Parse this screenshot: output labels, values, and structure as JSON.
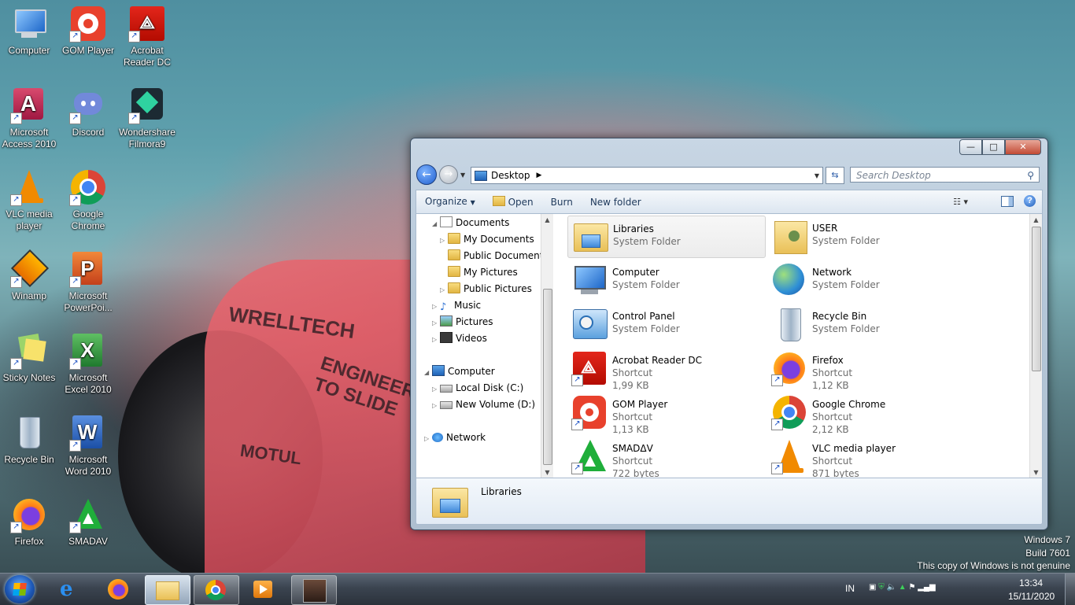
{
  "desktop": {
    "icons": [
      {
        "label": "Computer",
        "icon": "computer-icon"
      },
      {
        "label": "GOM Player",
        "icon": "gom-player-icon"
      },
      {
        "label": "Acrobat Reader DC",
        "icon": "acrobat-icon"
      },
      {
        "label": "Microsoft Access 2010",
        "icon": "access-icon"
      },
      {
        "label": "Discord",
        "icon": "discord-icon"
      },
      {
        "label": "Wondershare Filmora9",
        "icon": "filmora-icon"
      },
      {
        "label": "VLC media player",
        "icon": "vlc-icon"
      },
      {
        "label": "Google Chrome",
        "icon": "chrome-icon"
      },
      {
        "label": "Winamp",
        "icon": "winamp-icon"
      },
      {
        "label": "Microsoft PowerPoi...",
        "icon": "powerpoint-icon"
      },
      {
        "label": "Sticky Notes",
        "icon": "sticky-notes-icon"
      },
      {
        "label": "Microsoft Excel 2010",
        "icon": "excel-icon"
      },
      {
        "label": "Recycle Bin",
        "icon": "recycle-bin-icon"
      },
      {
        "label": "Microsoft Word 2010",
        "icon": "word-icon"
      },
      {
        "label": "Firefox",
        "icon": "firefox-icon"
      },
      {
        "label": "SMADAV",
        "icon": "smadav-icon"
      }
    ]
  },
  "wallpaper_text": [
    "WRELLTECH",
    "ENGINEERED TO SLIDE",
    "MOTUL"
  ],
  "window": {
    "address": "Desktop",
    "search_placeholder": "Search Desktop",
    "buttons": {
      "minimize": "—",
      "maximize": "□",
      "close": "✕"
    },
    "toolbar": {
      "organize": "Organize",
      "open": "Open",
      "burn": "Burn",
      "new_folder": "New folder"
    },
    "tree": [
      {
        "label": "Documents",
        "level": 1,
        "expander": "open"
      },
      {
        "label": "My Documents",
        "level": 2,
        "expander": "closed"
      },
      {
        "label": "Public Documents",
        "level": 2,
        "expander": "none"
      },
      {
        "label": "My Pictures",
        "level": 2,
        "expander": "none"
      },
      {
        "label": "Public Pictures",
        "level": 2,
        "expander": "closed"
      },
      {
        "label": "Music",
        "level": 1,
        "expander": "closed"
      },
      {
        "label": "Pictures",
        "level": 1,
        "expander": "closed"
      },
      {
        "label": "Videos",
        "level": 1,
        "expander": "closed"
      },
      {
        "label": "Computer",
        "level": 0,
        "expander": "open"
      },
      {
        "label": "Local Disk (C:)",
        "level": 1,
        "expander": "closed"
      },
      {
        "label": "New Volume (D:)",
        "level": 1,
        "expander": "closed"
      },
      {
        "label": "Network",
        "level": 0,
        "expander": "closed"
      }
    ],
    "items": [
      {
        "name": "Libraries",
        "type": "System Folder",
        "size": "",
        "icon": "libraries-icon",
        "selected": true
      },
      {
        "name": "USER",
        "type": "System Folder",
        "size": "",
        "icon": "user-folder-icon"
      },
      {
        "name": "Computer",
        "type": "System Folder",
        "size": "",
        "icon": "computer-icon"
      },
      {
        "name": "Network",
        "type": "System Folder",
        "size": "",
        "icon": "network-icon"
      },
      {
        "name": "Control Panel",
        "type": "System Folder",
        "size": "",
        "icon": "control-panel-icon"
      },
      {
        "name": "Recycle Bin",
        "type": "System Folder",
        "size": "",
        "icon": "recycle-bin-icon"
      },
      {
        "name": "Acrobat Reader DC",
        "type": "Shortcut",
        "size": "1,99 KB",
        "icon": "acrobat-icon"
      },
      {
        "name": "Firefox",
        "type": "Shortcut",
        "size": "1,12 KB",
        "icon": "firefox-icon"
      },
      {
        "name": "GOM Player",
        "type": "Shortcut",
        "size": "1,13 KB",
        "icon": "gom-player-icon"
      },
      {
        "name": "Google Chrome",
        "type": "Shortcut",
        "size": "2,12 KB",
        "icon": "chrome-icon"
      },
      {
        "name": "SMADΔV",
        "type": "Shortcut",
        "size": "722 bytes",
        "icon": "smadav-icon"
      },
      {
        "name": "VLC media player",
        "type": "Shortcut",
        "size": "871 bytes",
        "icon": "vlc-icon"
      }
    ],
    "details": {
      "name": "Libraries",
      "icon": "libraries-icon"
    }
  },
  "watermark": {
    "line1": "Windows 7",
    "line2": "Build 7601",
    "line3": "This copy of Windows is not genuine"
  },
  "taskbar": {
    "apps": [
      "internet-explorer-icon",
      "firefox-icon",
      "file-explorer-icon",
      "chrome-icon",
      "media-player-icon",
      "game-icon"
    ],
    "language": "IN",
    "time": "13:34",
    "date": "15/11/2020"
  }
}
